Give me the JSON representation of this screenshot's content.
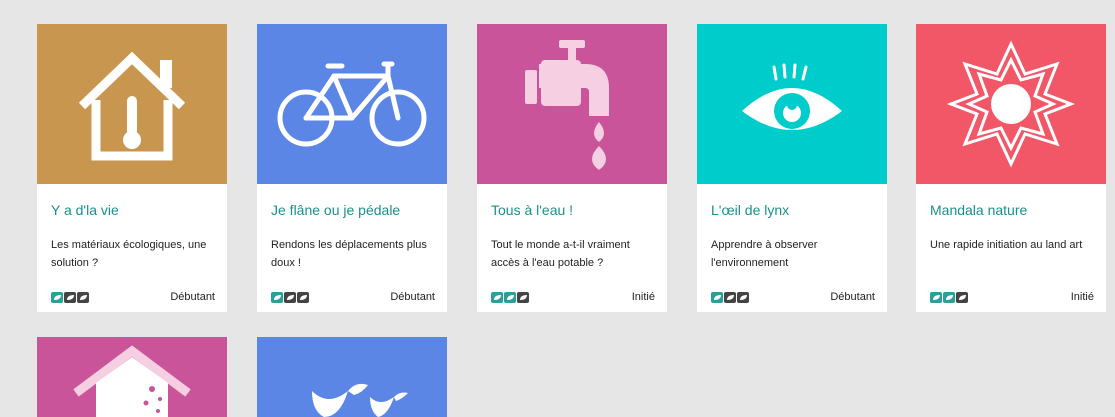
{
  "colors": {
    "teal_title": "#1b8f8f",
    "leaf_active": "#2aa198",
    "leaf_inactive": "#444444"
  },
  "cards": [
    {
      "title": "Y a d'la vie",
      "description": "Les matériaux écologiques, une solution ?",
      "level": "Débutant",
      "level_score": 1,
      "icon": "house-thermometer-icon",
      "color": "#c9964f"
    },
    {
      "title": "Je flâne ou je pédale",
      "description": "Rendons les déplacements plus doux !",
      "level": "Débutant",
      "level_score": 1,
      "icon": "bicycle-icon",
      "color": "#5b86e5"
    },
    {
      "title": "Tous à l'eau !",
      "description": "Tout le monde a-t-il vraiment accès à l'eau potable ?",
      "level": "Initié",
      "level_score": 2,
      "icon": "water-tap-icon",
      "color": "#c9549a"
    },
    {
      "title": "L'œil de lynx",
      "description": "Apprendre à observer l'environnement",
      "level": "Débutant",
      "level_score": 1,
      "icon": "eye-icon",
      "color": "#00cccc"
    },
    {
      "title": "Mandala nature",
      "description": "Une rapide initiation au land art",
      "level": "Initié",
      "level_score": 2,
      "icon": "mandala-icon",
      "color": "#f25767"
    },
    {
      "title": "",
      "description": "",
      "level": "",
      "icon": "house-broken-icon",
      "color": "#c9549a"
    },
    {
      "title": "",
      "description": "",
      "level": "",
      "icon": "birds-icon",
      "color": "#5b86e5"
    }
  ]
}
